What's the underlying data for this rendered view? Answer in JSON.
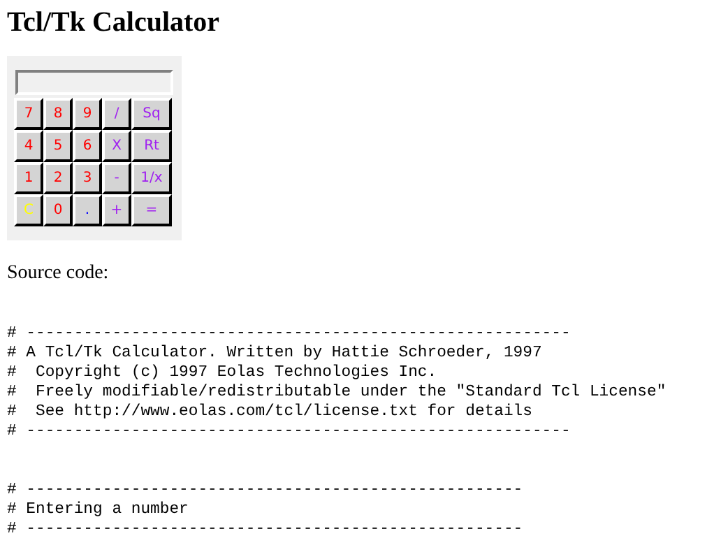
{
  "title": "Tcl/Tk Calculator",
  "calculator": {
    "keys": [
      {
        "label": "7",
        "color": "#ff0000"
      },
      {
        "label": "8",
        "color": "#ff0000"
      },
      {
        "label": "9",
        "color": "#ff0000"
      },
      {
        "label": "/",
        "color": "#a020f0"
      },
      {
        "label": "Sq",
        "color": "#a020f0"
      },
      {
        "label": "4",
        "color": "#ff0000"
      },
      {
        "label": "5",
        "color": "#ff0000"
      },
      {
        "label": "6",
        "color": "#ff0000"
      },
      {
        "label": "X",
        "color": "#a020f0"
      },
      {
        "label": "Rt",
        "color": "#a020f0"
      },
      {
        "label": "1",
        "color": "#ff0000"
      },
      {
        "label": "2",
        "color": "#ff0000"
      },
      {
        "label": "3",
        "color": "#ff0000"
      },
      {
        "label": "-",
        "color": "#a020f0"
      },
      {
        "label": "1/x",
        "color": "#a020f0"
      },
      {
        "label": "C",
        "color": "#ffff00"
      },
      {
        "label": "0",
        "color": "#ff0000"
      },
      {
        "label": ".",
        "color": "#0000ff"
      },
      {
        "label": "+",
        "color": "#a020f0"
      },
      {
        "label": "=",
        "color": "#a020f0"
      }
    ]
  },
  "source_label": "Source code:",
  "code_blocks": [
    [
      "# ---------------------------------------------------------",
      "# A Tcl/Tk Calculator. Written by Hattie Schroeder, 1997",
      "#  Copyright (c) 1997 Eolas Technologies Inc.",
      "#  Freely modifiable/redistributable under the \"Standard Tcl License\"",
      "#  See http://www.eolas.com/tcl/license.txt for details",
      "# ---------------------------------------------------------"
    ],
    [
      "# ----------------------------------------------------",
      "# Entering a number",
      "# ----------------------------------------------------"
    ]
  ]
}
